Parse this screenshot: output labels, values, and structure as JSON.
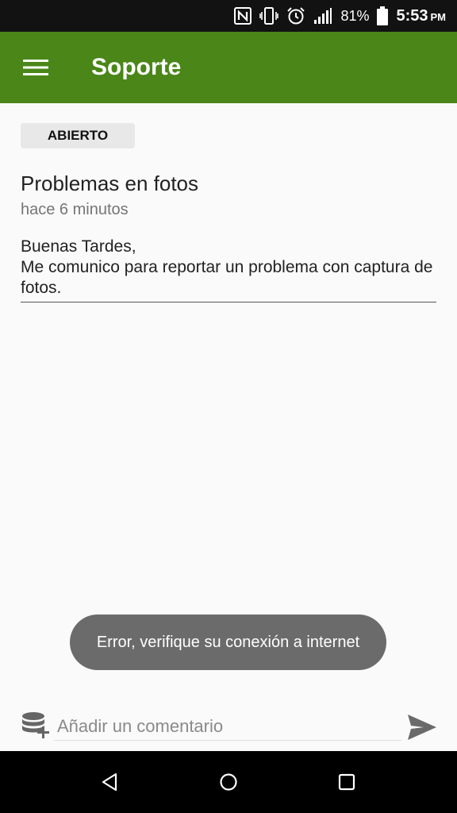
{
  "status_bar": {
    "icons": [
      "nfc-icon",
      "vibrate-icon",
      "alarm-icon",
      "signal-icon",
      "battery-icon"
    ],
    "battery": "81%",
    "time": "5:53",
    "ampm": "PM"
  },
  "app_bar": {
    "title": "Soporte",
    "color": "#4a8618",
    "menu_icon": "hamburger-menu-icon"
  },
  "ticket": {
    "status": "ABIERTO",
    "title": "Problemas en fotos",
    "time_ago": "hace 6 minutos",
    "body": "Buenas Tardes,\nMe comunico para reportar un problema con captura de fotos."
  },
  "toast": {
    "message": "Error, verifique su conexión a internet"
  },
  "comment": {
    "placeholder": "Añadir un comentario",
    "attach_icon": "database-add-icon",
    "send_icon": "send-icon"
  },
  "nav_bar": {
    "buttons": [
      "back-icon",
      "home-icon",
      "recents-icon"
    ]
  }
}
